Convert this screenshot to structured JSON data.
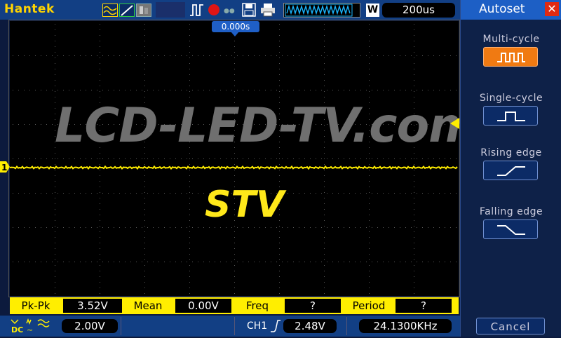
{
  "topbar": {
    "brand": "Hantek",
    "timebase": "200us",
    "waveform_mode": "W",
    "icons": [
      "channel-wave-icon",
      "ref-wave-icon",
      "math-wave-icon",
      "run-state-icon",
      "record-icon",
      "save-disk-icon",
      "print-icon",
      "waveform-strip-icon"
    ]
  },
  "screen": {
    "trigger_position": "0.000s",
    "watermark": "LCD-LED-TV.com",
    "signal_label": "STV",
    "channel_marker": "1",
    "trace_color": "#ffee00"
  },
  "measurements": [
    {
      "label": "Pk-Pk",
      "value": "3.52V"
    },
    {
      "label": "Mean",
      "value": "0.00V"
    },
    {
      "label": "Freq",
      "value": "?"
    },
    {
      "label": "Period",
      "value": "?"
    }
  ],
  "status": {
    "coupling": "DC",
    "volts_div": "2.00V",
    "trigger_channel": "CH1",
    "trigger_level": "2.48V",
    "frequency": "24.1300KHz"
  },
  "panel": {
    "title": "Autoset",
    "close_icon": "close-icon",
    "options": [
      {
        "label": "Multi-cycle",
        "icon": "multi-cycle-icon",
        "active": true
      },
      {
        "label": "Single-cycle",
        "icon": "single-cycle-icon",
        "active": false
      },
      {
        "label": "Rising edge",
        "icon": "rising-edge-icon",
        "active": false
      },
      {
        "label": "Falling edge",
        "icon": "falling-edge-icon",
        "active": false
      }
    ],
    "cancel_label": "Cancel"
  },
  "colors": {
    "accent_orange": "#f07a12",
    "trace_yellow": "#ffee00",
    "header_blue": "#1d5fc5",
    "close_red": "#e02a12"
  }
}
